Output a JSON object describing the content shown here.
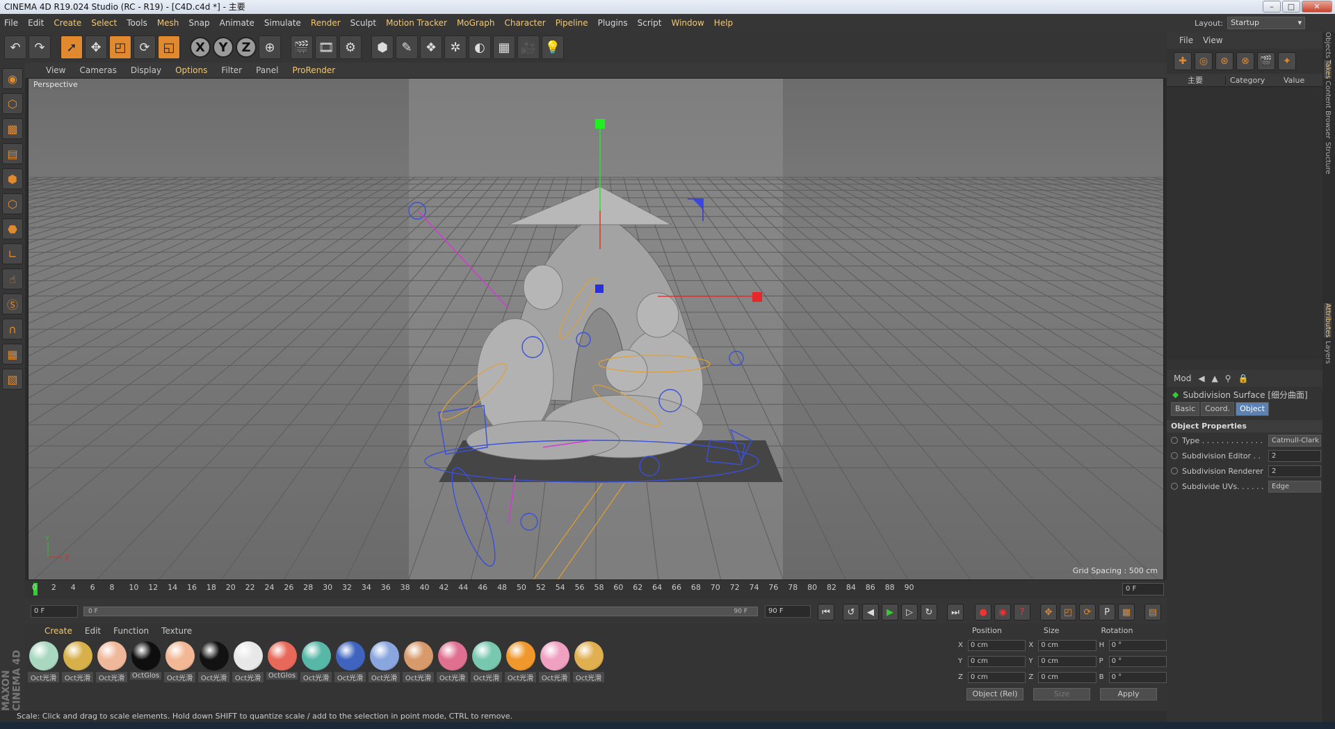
{
  "window": {
    "title": "CINEMA 4D R19.024 Studio (RC - R19) - [C4D.c4d *] - 主要"
  },
  "menubar": [
    "File",
    "Edit",
    "Create",
    "Select",
    "Tools",
    "Mesh",
    "Snap",
    "Animate",
    "Simulate",
    "Render",
    "Sculpt",
    "Motion Tracker",
    "MoGraph",
    "Character",
    "Pipeline",
    "Plugins",
    "Script",
    "Window",
    "Help"
  ],
  "menubar_accent": [
    "Create",
    "Select",
    "Mesh",
    "Render",
    "Motion Tracker",
    "MoGraph",
    "Character",
    "Pipeline",
    "Window",
    "Help"
  ],
  "layout": {
    "label": "Layout:",
    "value": "Startup"
  },
  "toolbar": {
    "x": "X",
    "y": "Y",
    "z": "Z"
  },
  "viewport": {
    "menu": [
      "View",
      "Cameras",
      "Display",
      "Options",
      "Filter",
      "Panel",
      "ProRender"
    ],
    "menu_accent": [
      "Options",
      "ProRender"
    ],
    "label": "Perspective",
    "grid_spacing": "Grid Spacing : 500 cm",
    "axis_y": "Y",
    "axis_x": "X"
  },
  "timeline": {
    "ticks": [
      "0",
      "2",
      "4",
      "6",
      "8",
      "10",
      "12",
      "14",
      "16",
      "18",
      "20",
      "22",
      "24",
      "26",
      "28",
      "30",
      "32",
      "34",
      "36",
      "38",
      "40",
      "42",
      "44",
      "46",
      "48",
      "50",
      "52",
      "54",
      "56",
      "58",
      "60",
      "62",
      "64",
      "66",
      "68",
      "70",
      "72",
      "74",
      "76",
      "78",
      "80",
      "82",
      "84",
      "86",
      "88",
      "90"
    ],
    "current_frame": "0 F"
  },
  "playback": {
    "start": "0 F",
    "range_start": "0 F",
    "range_end": "90 F",
    "end": "90 F"
  },
  "materials": {
    "menu": [
      "Create",
      "Edit",
      "Function",
      "Texture"
    ],
    "items": [
      {
        "name": "Oct光滑",
        "color": "#a8d8c0"
      },
      {
        "name": "Oct光滑",
        "color": "#d8b04a"
      },
      {
        "name": "Oct光滑",
        "color": "#f0b89a"
      },
      {
        "name": "OctGlos",
        "color": "#0e0e0e"
      },
      {
        "name": "Oct光滑",
        "color": "#f2b896"
      },
      {
        "name": "Oct光滑",
        "color": "#121212"
      },
      {
        "name": "Oct光滑",
        "color": "#e8e8e8"
      },
      {
        "name": "OctGlos",
        "color": "#e8685a"
      },
      {
        "name": "Oct光滑",
        "color": "#58b8a8"
      },
      {
        "name": "Oct光滑",
        "color": "#3f64c0"
      },
      {
        "name": "Oct光滑",
        "color": "#8aa6de"
      },
      {
        "name": "Oct光滑",
        "color": "#d89a6a"
      },
      {
        "name": "Oct光滑",
        "color": "#e07090"
      },
      {
        "name": "Oct光滑",
        "color": "#78c8b0"
      },
      {
        "name": "Oct光滑",
        "color": "#f0982c"
      },
      {
        "name": "Oct光滑",
        "color": "#f0a0c0"
      },
      {
        "name": "Oct光滑",
        "color": "#e0b050"
      }
    ]
  },
  "coords": {
    "headers": {
      "position": "Position",
      "size": "Size",
      "rotation": "Rotation"
    },
    "rows": [
      {
        "pa": "X",
        "pv": "0 cm",
        "sa": "X",
        "sv": "0 cm",
        "ra": "H",
        "rv": "0 °"
      },
      {
        "pa": "Y",
        "pv": "0 cm",
        "sa": "Y",
        "sv": "0 cm",
        "ra": "P",
        "rv": "0 °"
      },
      {
        "pa": "Z",
        "pv": "0 cm",
        "sa": "Z",
        "sv": "0 cm",
        "ra": "B",
        "rv": "0 °"
      }
    ],
    "mode": "Object (Rel)",
    "size_mode": "Size",
    "apply": "Apply"
  },
  "status": "Scale: Click and drag to scale elements. Hold down SHIFT to quantize scale / add to the selection in point mode, CTRL to remove.",
  "right": {
    "menu": [
      "File",
      "View"
    ],
    "take_col": "主要",
    "category": "Category",
    "value": "Value",
    "attr_mode": "Mod",
    "object_title": "Subdivision Surface [细分曲面]",
    "tabs": [
      "Basic",
      "Coord.",
      "Object"
    ],
    "section": "Object Properties",
    "props": [
      {
        "name": "Type . . . . . . . . . . . . . .",
        "value": "Catmull-Clark"
      },
      {
        "name": "Subdivision Editor . .",
        "value": "2"
      },
      {
        "name": "Subdivision Renderer",
        "value": "2"
      },
      {
        "name": "Subdivide UVs. . . . . .",
        "value": "Edge"
      }
    ],
    "vtabs": [
      "Objects",
      "Takes",
      "Content Browser",
      "Structure",
      "Attributes",
      "Layers"
    ]
  },
  "logo": "MAXON CINEMA 4D"
}
